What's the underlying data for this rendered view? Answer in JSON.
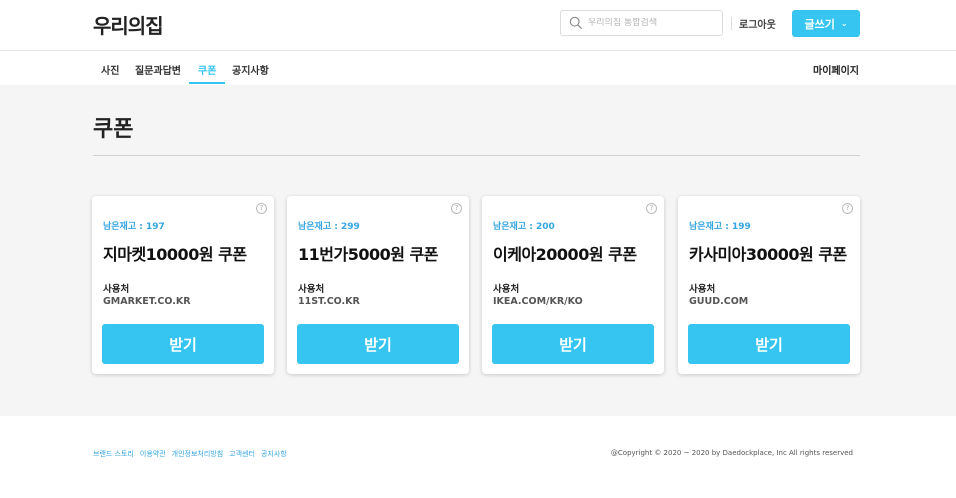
{
  "header": {
    "logo": "우리의집",
    "search_placeholder": "우리의집 통합검색",
    "logout": "로그아웃",
    "write_button": "글쓰기",
    "write_chevron": "⌄"
  },
  "subnav": {
    "items": [
      {
        "label": "사진",
        "active": false
      },
      {
        "label": "질문과답변",
        "active": false
      },
      {
        "label": "쿠폰",
        "active": true
      },
      {
        "label": "공지사항",
        "active": false
      }
    ],
    "mypage": "마이페이지"
  },
  "main": {
    "title": "쿠폰",
    "stock_prefix": "남은재고 : ",
    "usage_label": "사용처",
    "get_button": "받기",
    "help_icon": "?",
    "coupons": [
      {
        "stock": "197",
        "name": "지마켓10000원 쿠폰",
        "usage": "GMARKET.CO.KR"
      },
      {
        "stock": "299",
        "name": "11번가5000원 쿠폰",
        "usage": "11ST.CO.KR"
      },
      {
        "stock": "200",
        "name": "이케아20000원 쿠폰",
        "usage": "IKEA.COM/KR/KO"
      },
      {
        "stock": "199",
        "name": "카사미아30000원 쿠폰",
        "usage": "GUUD.COM"
      }
    ]
  },
  "footer": {
    "links": [
      "브랜드 스토리",
      "이용약관",
      "개인정보처리방침",
      "고객센터",
      "공지사항"
    ],
    "copyright": "@Copyright © 2020 ~ 2020 by Daedockplace, Inc All rights reserved"
  },
  "colors": {
    "accent": "#35c5f0",
    "stock_text": "#35a5e0",
    "main_bg": "#f5f5f5"
  }
}
